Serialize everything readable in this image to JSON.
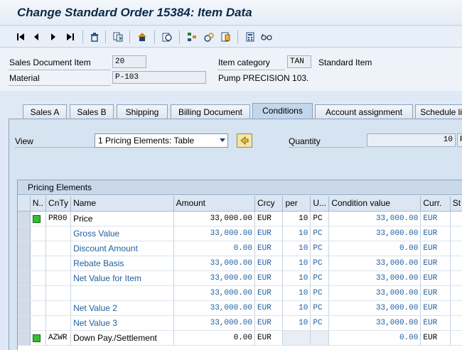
{
  "window": {
    "title": "Change Standard Order 15384: Item Data"
  },
  "toolbar": {
    "buttons": [
      {
        "name": "first-icon",
        "glyph": "⏮"
      },
      {
        "name": "previous-icon",
        "glyph": "◀"
      },
      {
        "name": "next-icon",
        "glyph": "▶"
      },
      {
        "name": "last-icon",
        "glyph": "⏭"
      },
      {
        "name": "delete-icon",
        "glyph": "🗑"
      },
      {
        "name": "copy-icon",
        "glyph": "⎘"
      },
      {
        "name": "header-icon",
        "glyph": "⌂"
      },
      {
        "name": "display-icon",
        "glyph": "⊙"
      },
      {
        "name": "hierarchy-icon",
        "glyph": "⚙"
      },
      {
        "name": "analysis-icon",
        "glyph": "⚗"
      },
      {
        "name": "document-icon",
        "glyph": "▤"
      },
      {
        "name": "calculator-icon",
        "glyph": "▦"
      },
      {
        "name": "glasses-icon",
        "glyph": "∞"
      }
    ]
  },
  "header": {
    "sales_doc_item_label": "Sales Document Item",
    "sales_doc_item_value": "20",
    "item_category_label": "Item category",
    "item_category_value": "TAN",
    "item_category_desc": "Standard Item",
    "material_label": "Material",
    "material_value": "P-103",
    "material_desc": "Pump PRECISION 103."
  },
  "tabs": [
    "Sales A",
    "Sales B",
    "Shipping",
    "Billing Document",
    "Conditions",
    "Account assignment",
    "Schedule lin"
  ],
  "active_tab": "Conditions",
  "conditions": {
    "view_label": "View",
    "view_value": "1 Pricing Elements: Table",
    "quantity_label": "Quantity",
    "quantity_value": "10",
    "quantity_unit": "P"
  },
  "table": {
    "title": "Pricing Elements",
    "columns": [
      "N..",
      "CnTy",
      "Name",
      "Amount",
      "Crcy",
      "per",
      "U...",
      "Condition value",
      "Curr.",
      "St"
    ],
    "rows": [
      {
        "status": true,
        "cnty": "PR00",
        "name": "Price",
        "amount": "33,000.00",
        "crcy": "EUR",
        "per": "10",
        "unit": "PC",
        "cond_value": "33,000.00",
        "curr": "EUR",
        "blue": false,
        "editable": true
      },
      {
        "status": false,
        "cnty": "",
        "name": "Gross Value",
        "amount": "33,000.00",
        "crcy": "EUR",
        "per": "10",
        "unit": "PC",
        "cond_value": "33,000.00",
        "curr": "EUR",
        "blue": true,
        "editable": false
      },
      {
        "status": false,
        "cnty": "",
        "name": "Discount Amount",
        "amount": "0.00",
        "crcy": "EUR",
        "per": "10",
        "unit": "PC",
        "cond_value": "0.00",
        "curr": "EUR",
        "blue": true,
        "editable": false
      },
      {
        "status": false,
        "cnty": "",
        "name": "Rebate Basis",
        "amount": "33,000.00",
        "crcy": "EUR",
        "per": "10",
        "unit": "PC",
        "cond_value": "33,000.00",
        "curr": "EUR",
        "blue": true,
        "editable": false
      },
      {
        "status": false,
        "cnty": "",
        "name": "Net Value for Item",
        "amount": "33,000.00",
        "crcy": "EUR",
        "per": "10",
        "unit": "PC",
        "cond_value": "33,000.00",
        "curr": "EUR",
        "blue": true,
        "editable": false
      },
      {
        "status": false,
        "cnty": "",
        "name": "",
        "amount": "33,000.00",
        "crcy": "EUR",
        "per": "10",
        "unit": "PC",
        "cond_value": "33,000.00",
        "curr": "EUR",
        "blue": true,
        "editable": false
      },
      {
        "status": false,
        "cnty": "",
        "name": "Net Value 2",
        "amount": "33,000.00",
        "crcy": "EUR",
        "per": "10",
        "unit": "PC",
        "cond_value": "33,000.00",
        "curr": "EUR",
        "blue": true,
        "editable": false
      },
      {
        "status": false,
        "cnty": "",
        "name": "Net Value 3",
        "amount": "33,000.00",
        "crcy": "EUR",
        "per": "10",
        "unit": "PC",
        "cond_value": "33,000.00",
        "curr": "EUR",
        "blue": true,
        "editable": false
      },
      {
        "status": true,
        "cnty": "AZWR",
        "name": "Down Pay./Settlement",
        "amount": "0.00",
        "crcy": "EUR",
        "per": "",
        "unit": "",
        "cond_value": "0.00",
        "curr": "EUR",
        "blue": false,
        "editable": false
      }
    ]
  },
  "colors": {
    "status_green": "#2fc12f",
    "link_blue": "#1f5e9f",
    "panel_bg": "#d6e3f0"
  }
}
